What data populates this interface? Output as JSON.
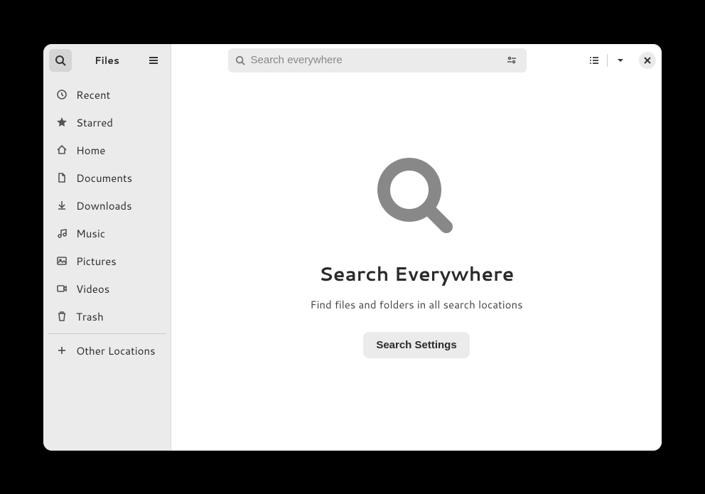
{
  "sidebar": {
    "title": "Files",
    "items": [
      {
        "label": "Recent",
        "icon": "clock"
      },
      {
        "label": "Starred",
        "icon": "star"
      },
      {
        "label": "Home",
        "icon": "home"
      },
      {
        "label": "Documents",
        "icon": "document"
      },
      {
        "label": "Downloads",
        "icon": "download"
      },
      {
        "label": "Music",
        "icon": "music"
      },
      {
        "label": "Pictures",
        "icon": "picture"
      },
      {
        "label": "Videos",
        "icon": "video"
      },
      {
        "label": "Trash",
        "icon": "trash"
      }
    ],
    "other_locations_label": "Other Locations"
  },
  "search": {
    "placeholder": "Search everywhere"
  },
  "main": {
    "title": "Search Everywhere",
    "subtitle": "Find files and folders in all search locations",
    "settings_button": "Search Settings"
  }
}
